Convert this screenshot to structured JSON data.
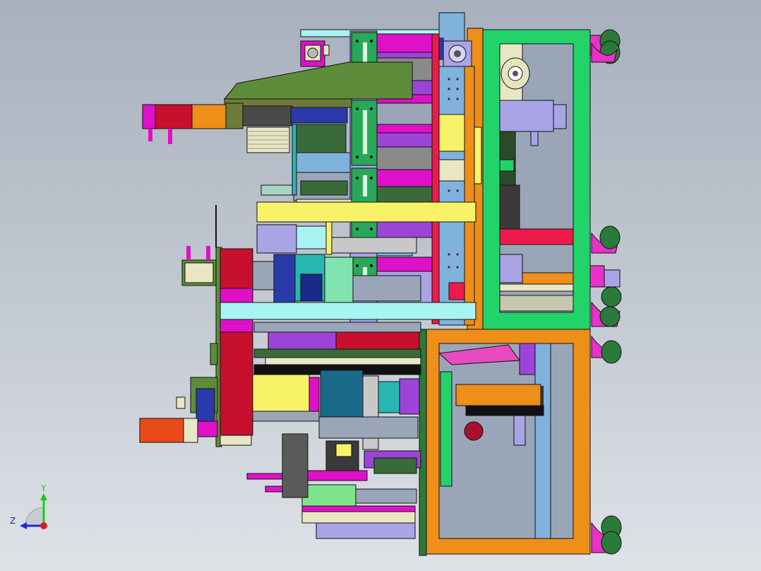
{
  "viewport": {
    "background_top": "#a7b0bd",
    "background_bottom": "#dfe2e7"
  },
  "model": {
    "description_icon": "cad-assembly-machine",
    "colors": {
      "frame_green": "#22d36a",
      "frame_orange": "#ee8f1a",
      "magenta": "#e010c8",
      "crimson": "#d0102e",
      "yellow": "#f8f268",
      "cyan": "#a8f4f2",
      "olive": "#5e8c3a",
      "purple": "#9c44d8",
      "steel_blue": "#7fb2dc",
      "teal": "#28b7b0",
      "lavender": "#a8a4e6",
      "caster_magenta": "#e832c8",
      "caster_green": "#2a7a3a"
    }
  },
  "triad": {
    "y_label": "Y",
    "z_label": "Z",
    "y_color": "#1ec81e",
    "z_color": "#1e2ad2",
    "x_color": "#d81e1e"
  }
}
